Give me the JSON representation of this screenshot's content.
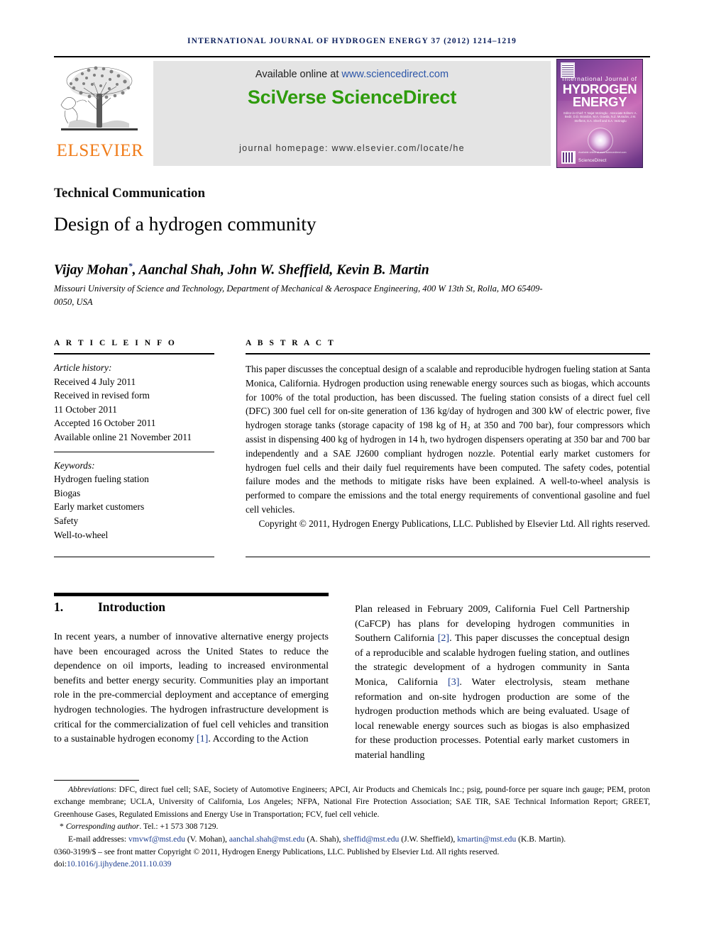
{
  "running_head": "INTERNATIONAL JOURNAL OF HYDROGEN ENERGY 37 (2012) 1214–1219",
  "masthead": {
    "publisher_word": "ELSEVIER",
    "publisher_color": "#f07c1a",
    "available_prefix": "Available online at ",
    "available_url": "www.sciencedirect.com",
    "brand": "SciVerse ScienceDirect",
    "brand_color": "#2e9b0c",
    "homepage": "journal homepage: www.elsevier.com/locate/he",
    "banner_bg": "#e4e4e4"
  },
  "cover": {
    "line_small": "International Journal of",
    "line_big_1": "HYDROGEN",
    "line_big_2": "ENERGY",
    "editors": "Editor-in-Chief: T. Nejat Veziroglu · Associate Editors: A. Bedir, D.D. Brandon, M.A. Gowda, N.Z. Muradov, J.M. Steffens, S.A. Sherif and S.A. Veziroglu",
    "sciencedirect_tag": "Available online at www.sciencedirect.com",
    "sciencedirect": "ScienceDirect"
  },
  "article": {
    "type_label": "Technical Communication",
    "title": "Design of a hydrogen community",
    "authors_text": "Vijay Mohan",
    "authors_star": "*",
    "authors_rest": ", Aanchal Shah, John W. Sheffield, Kevin B. Martin",
    "affiliation": "Missouri University of Science and Technology, Department of Mechanical & Aerospace Engineering, 400 W 13th St, Rolla, MO 65409-0050, USA"
  },
  "info": {
    "heading": "A R T I C L E   I N F O",
    "history_label": "Article history:",
    "history": [
      "Received 4 July 2011",
      "Received in revised form",
      "11 October 2011",
      "Accepted 16 October 2011",
      "Available online 21 November 2011"
    ],
    "keywords_label": "Keywords:",
    "keywords": [
      "Hydrogen fueling station",
      "Biogas",
      "Early market customers",
      "Safety",
      "Well-to-wheel"
    ]
  },
  "abstract": {
    "heading": "A B S T R A C T",
    "body": "This paper discusses the conceptual design of a scalable and reproducible hydrogen fueling station at Santa Monica, California. Hydrogen production using renewable energy sources such as biogas, which accounts for 100% of the total production, has been discussed. The fueling station consists of a direct fuel cell (DFC) 300 fuel cell for on-site generation of 136 kg/day of hydrogen and 300 kW of electric power, five hydrogen storage tanks (storage capacity of 198 kg of H₂ at 350 and 700 bar), four compressors which assist in dispensing 400 kg of hydrogen in 14 h, two hydrogen dispensers operating at 350 bar and 700 bar independently and a SAE J2600 compliant hydrogen nozzle. Potential early market customers for hydrogen fuel cells and their daily fuel requirements have been computed. The safety codes, potential failure modes and the methods to mitigate risks have been explained. A well-to-wheel analysis is performed to compare the emissions and the total energy requirements of conventional gasoline and fuel cell vehicles.",
    "copyright": "Copyright © 2011, Hydrogen Energy Publications, LLC. Published by Elsevier Ltd. All rights reserved."
  },
  "body": {
    "section_number": "1.",
    "section_title": "Introduction",
    "left_paragraph_a": "In recent years, a number of innovative alternative energy projects have been encouraged across the United States to reduce the dependence on oil imports, leading to increased environmental benefits and better energy security. Communities play an important role in the pre-commercial deployment and acceptance of emerging hydrogen technologies. The hydrogen infrastructure development is critical for the commercialization of fuel cell vehicles and transition to a sustainable hydrogen economy ",
    "left_ref_1": "[1]",
    "left_paragraph_b": ". According to the Action",
    "right_paragraph_a": "Plan released in February 2009, California Fuel Cell Partnership (CaFCP) has plans for developing hydrogen communities in Southern California ",
    "right_ref_2": "[2]",
    "right_paragraph_b": ". This paper discusses the conceptual design of a reproducible and scalable hydrogen fueling station, and outlines the strategic development of a hydrogen community in Santa Monica, California ",
    "right_ref_3": "[3]",
    "right_paragraph_c": ". Water electrolysis, steam methane reformation and on-site hydrogen production are some of the hydrogen production methods which are being evaluated. Usage of local renewable energy sources such as biogas is also emphasized for these production processes. Potential early market customers in material handling"
  },
  "footnotes": {
    "abbrev_label": "Abbreviations",
    "abbrev_text": ": DFC, direct fuel cell; SAE, Society of Automotive Engineers; APCI, Air Products and Chemicals Inc.; psig, pound-force per square inch gauge; PEM, proton exchange membrane; UCLA, University of California, Los Angeles; NFPA, National Fire Protection Association; SAE TIR, SAE Technical Information Report; GREET, Greenhouse Gases, Regulated Emissions and Energy Use in Transportation; FCV, fuel cell vehicle.",
    "corresponding_star": "*",
    "corresponding_label": "Corresponding author",
    "corresponding_tel": ". Tel.: +1 573 308 7129.",
    "email_label": "E-mail addresses: ",
    "emails": [
      {
        "address": "vmvwf@mst.edu",
        "name": " (V. Mohan), "
      },
      {
        "address": "aanchal.shah@mst.edu",
        "name": " (A. Shah), "
      },
      {
        "address": "sheffid@mst.edu",
        "name": " (J.W. Sheffield), "
      },
      {
        "address": "kmartin@mst.edu",
        "name": " (K.B. Martin)."
      }
    ],
    "issn_line": "0360-3199/$ – see front matter Copyright © 2011, Hydrogen Energy Publications, LLC. Published by Elsevier Ltd. All rights reserved.",
    "doi_label": "doi:",
    "doi_value": "10.1016/j.ijhydene.2011.10.039"
  }
}
